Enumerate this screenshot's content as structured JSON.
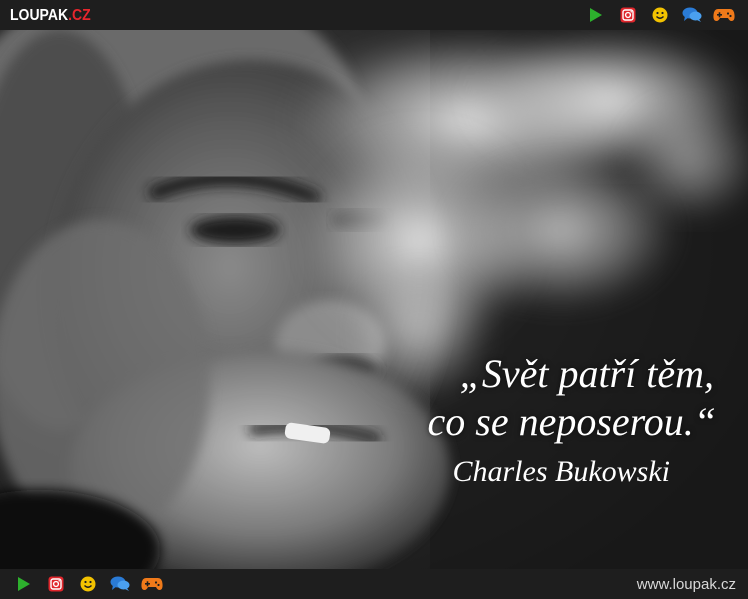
{
  "header": {
    "logo_main": "LOUPAK",
    "logo_tld": ".CZ"
  },
  "nav_icons": [
    {
      "name": "play-icon",
      "color": "#2db12d"
    },
    {
      "name": "instagram-icon",
      "color": "#e0262c"
    },
    {
      "name": "smiley-icon",
      "color": "#f2c200"
    },
    {
      "name": "chat-icon",
      "color": "#2a7bd6"
    },
    {
      "name": "gamepad-icon",
      "color": "#f07a1a"
    }
  ],
  "quote": {
    "line1": "„Svět patří těm,",
    "line2": "co se neposerou.“",
    "author": "Charles Bukowski"
  },
  "footer": {
    "url": "www.loupak.cz"
  }
}
